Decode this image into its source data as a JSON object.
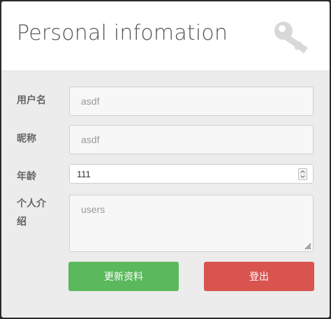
{
  "header": {
    "title": "Personal infomation",
    "icon": "key-icon"
  },
  "form": {
    "username": {
      "label": "用户名",
      "value": "asdf"
    },
    "nickname": {
      "label": "昵称",
      "value": "asdf"
    },
    "age": {
      "label": "年龄",
      "value": "111"
    },
    "bio": {
      "label_line1": "个人介",
      "label_line2": "绍",
      "placeholder": "users"
    }
  },
  "buttons": {
    "update_label": "更新资料",
    "logout_label": "登出"
  },
  "colors": {
    "update": "#5cb85c",
    "logout": "#d9534f"
  }
}
